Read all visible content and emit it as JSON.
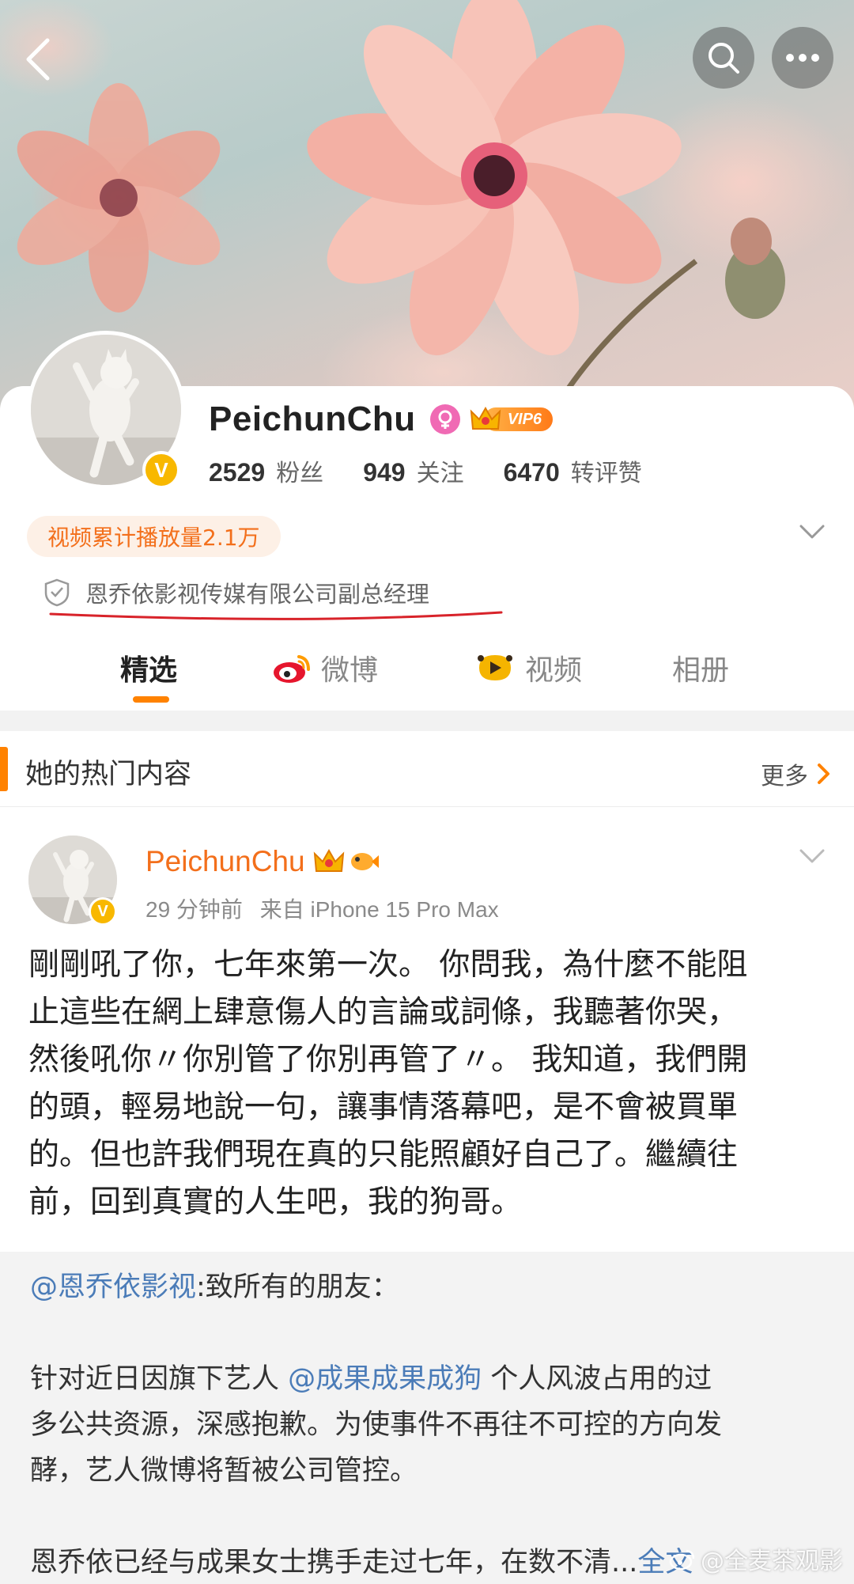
{
  "header": {
    "back_icon": "chevron-left-icon",
    "search_icon": "search-icon",
    "more_icon": "more-horizontal-icon"
  },
  "profile": {
    "name": "PeichunChu",
    "gender": "female",
    "vip_label": "VIP6",
    "verified_mark": "V",
    "stats": [
      {
        "value": "2529",
        "label": "粉丝"
      },
      {
        "value": "949",
        "label": "关注"
      },
      {
        "value": "6470",
        "label": "转评赞"
      }
    ],
    "views_pill": "视频累计播放量2.1万",
    "company": "恩乔依影视传媒有限公司副总经理"
  },
  "tabs": [
    {
      "label": "精选",
      "active": true
    },
    {
      "label": "微博",
      "icon": "weibo-icon"
    },
    {
      "label": "视频",
      "icon": "video-icon"
    },
    {
      "label": "相册"
    }
  ],
  "hot": {
    "title": "她的热门内容",
    "more_label": "更多"
  },
  "post": {
    "author": "PeichunChu",
    "time": "29 分钟前",
    "source": "来自 iPhone 15 Pro Max",
    "lines": [
      "剛剛吼了你，七年來第一次。 你問我，為什麼不能阻",
      "止這些在網上肆意傷人的言論或詞條，我聽著你哭，",
      "然後吼你〃你別管了你別再管了〃。 我知道，我們開",
      "的頭，輕易地說一句，讓事情落幕吧，是不會被買單",
      "的。但也許我們現在真的只能照顧好自己了。繼續往",
      "前，回到真實的人生吧，我的狗哥。"
    ],
    "repost": {
      "mention1": "@恩乔依影视",
      "line1_rest": ":致所有的朋友：",
      "line2_pre": "针对近日因旗下艺人 ",
      "mention2": "@成果成果成狗",
      "line2_post": " 个人风波占用的过",
      "line3": "多公共资源，深感抱歉。为使事件不再往不可控的方向发",
      "line4": "酵，艺人微博将暂被公司管控。",
      "line5": "恩乔依已经与成果女士携手走过七年，在数不清...",
      "full_text": "全文"
    }
  },
  "watermark": "@全麦茶观影",
  "colors": {
    "accent": "#ff8200",
    "name_orange": "#f36f1b",
    "link_blue": "#4b7cb8",
    "verified_gold": "#f8b800"
  }
}
